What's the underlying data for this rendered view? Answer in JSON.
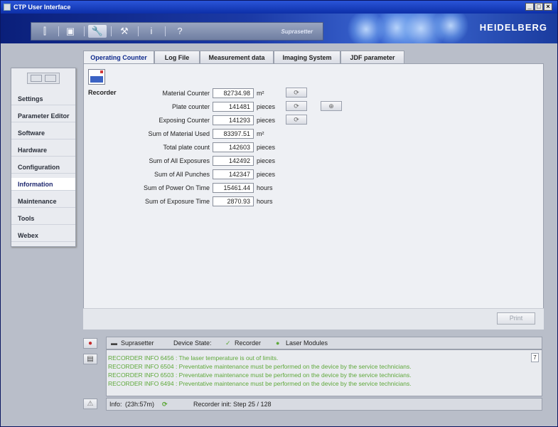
{
  "window": {
    "title": "CTP User Interface"
  },
  "banner": {
    "brand": "HEIDELBERG",
    "product": "Suprasetter"
  },
  "toolbar": {
    "items": [
      {
        "name": "chart-icon",
        "glyph": "⫿",
        "active": false
      },
      {
        "name": "device-icon",
        "glyph": "▣",
        "active": false
      },
      {
        "name": "wrench-icon",
        "glyph": "🔧",
        "active": true
      },
      {
        "name": "tools-icon",
        "glyph": "⚒",
        "active": false
      },
      {
        "name": "info-icon",
        "glyph": "i",
        "active": false
      },
      {
        "name": "help-icon",
        "glyph": "?",
        "active": false
      }
    ]
  },
  "sidebar": {
    "items": [
      {
        "label": "Settings",
        "active": false
      },
      {
        "label": "Parameter Editor",
        "active": false
      },
      {
        "label": "Software",
        "active": false
      },
      {
        "label": "Hardware",
        "active": false
      },
      {
        "label": "Configuration",
        "active": false
      },
      {
        "label": "Information",
        "active": true
      },
      {
        "label": "Maintenance",
        "active": false
      },
      {
        "label": "Tools",
        "active": false
      },
      {
        "label": "Webex",
        "active": false
      }
    ]
  },
  "tabs": [
    {
      "label": "Operating Counter",
      "active": true
    },
    {
      "label": "Log File",
      "active": false
    },
    {
      "label": "Measurement data",
      "active": false
    },
    {
      "label": "Imaging System",
      "active": false
    },
    {
      "label": "JDF parameter",
      "active": false
    }
  ],
  "recorder": {
    "label": "Recorder",
    "counters": [
      {
        "label": "Material Counter",
        "value": "82734.98",
        "unit": "m²",
        "reset": true,
        "extra": false
      },
      {
        "label": "Plate counter",
        "value": "141481",
        "unit": "pieces",
        "reset": true,
        "extra": true
      },
      {
        "label": "Exposing Counter",
        "value": "141293",
        "unit": "pieces",
        "reset": true,
        "extra": false
      },
      {
        "label": "Sum of Material Used",
        "value": "83397.51",
        "unit": "m²",
        "reset": false,
        "extra": false
      },
      {
        "label": "Total plate count",
        "value": "142603",
        "unit": "pieces",
        "reset": false,
        "extra": false
      },
      {
        "label": "Sum of All Exposures",
        "value": "142492",
        "unit": "pieces",
        "reset": false,
        "extra": false
      },
      {
        "label": "Sum of All Punches",
        "value": "142347",
        "unit": "pieces",
        "reset": false,
        "extra": false
      },
      {
        "label": "Sum of Power On Time",
        "value": "15461.44",
        "unit": "hours",
        "reset": false,
        "extra": false
      },
      {
        "label": "Sum of Exposure Time",
        "value": "2870.93",
        "unit": "hours",
        "reset": false,
        "extra": false
      }
    ]
  },
  "panel": {
    "print_label": "Print"
  },
  "status": {
    "device": "Suprasetter",
    "device_state_label": "Device State:",
    "recorder_label": "Recorder",
    "laser_label": "Laser Modules"
  },
  "messages": {
    "count": "7",
    "lines": [
      "RECORDER INFO 6456 : The laser temperature is out of limits.",
      "RECORDER INFO 6504 : Preventative maintenance must be performed on the device by the service technicians.",
      "RECORDER INFO 6503 : Preventative maintenance must be performed on the device by the service technicians.",
      "RECORDER INFO 6494 : Preventative maintenance must be performed on the device by the service technicians."
    ]
  },
  "info": {
    "label": "Info:",
    "time": "(23h:57m)",
    "step": "Recorder init: Step  25 / 128"
  },
  "colors": {
    "accent": "#1e2870",
    "message_green": "#5ea83a",
    "title_blue": "#0d2fa8"
  }
}
